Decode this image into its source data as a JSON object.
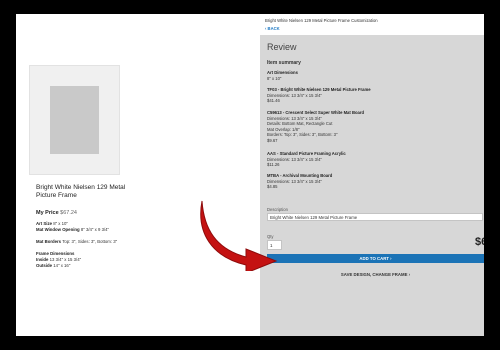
{
  "product": {
    "title": "Bright White Nielsen 129 Metal Picture Frame",
    "price_label": "My Price",
    "price": "$67.24",
    "specs": [
      {
        "label": "Art Size",
        "value": "8\" x 10\""
      },
      {
        "label": "Mat Window Opening",
        "value": "8\" 3/4\" x 9 3/4\""
      },
      {
        "label": "Mat Borders",
        "value": "Top: 3\", Sides: 3\", Bottom: 3\""
      },
      {
        "label": "Frame Dimensions",
        "value": ""
      },
      {
        "label": "Inside",
        "value": "13 3/4\" x 15 3/4\""
      },
      {
        "label": "Outside",
        "value": "14\" x 16\""
      }
    ]
  },
  "panel": {
    "breadcrumb": "Bright White Nielsen 129 Metal Picture Frame Customization",
    "back": "‹ BACK",
    "review_heading": "Review",
    "summary_heading": "Item summary",
    "items": [
      {
        "title": "Art Dimensions",
        "lines": [
          "8\" x 10\""
        ]
      },
      {
        "title": "TF03 - Bright White Nielsen 129 Metal Picture Frame",
        "lines": [
          "Dimensions: 13 3/4\" x 15 3/4\"",
          "$41.46"
        ]
      },
      {
        "title": "C59613 - Crescent Select Super White Mat Board",
        "lines": [
          "Dimensions: 13 3/4\" x 15 3/4\"",
          "Details: Bottom Mat, Rectangle Cut",
          "Mat Overlap: 1/8\"",
          "Borders: Top: 3\", Sides: 3\", Bottom: 3\"",
          "$9.67"
        ]
      },
      {
        "title": "AAS - Standard Picture Framing Acrylic",
        "lines": [
          "Dimensions: 13 3/4\" x 15 3/4\"",
          "$11.26"
        ]
      },
      {
        "title": "MTBA - Archival Mounting Board",
        "lines": [
          "Dimensions: 13 3/4\" x 15 3/4\"",
          "$4.85"
        ]
      }
    ],
    "description_label": "Description",
    "description_value": "Bright White Nielsen 129 Metal Picture Frame",
    "qty_label": "Qty",
    "qty_value": "1",
    "total": "$6",
    "add_to_cart": "ADD TO CART ›",
    "save_design": "SAVE DESIGN, CHANGE FRAME ›"
  },
  "colors": {
    "accent": "#1b73b6",
    "arrow": "#c41212",
    "panel_bg": "#d7d7d7",
    "backdrop": "#000000"
  }
}
